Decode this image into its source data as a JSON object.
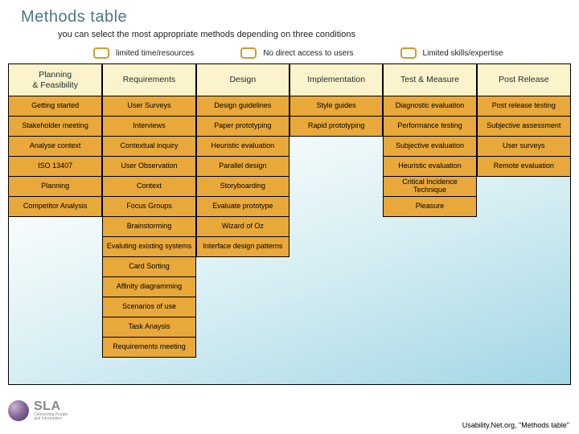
{
  "title": "Methods table",
  "subtitle": "you can select the most appropriate methods depending on three conditions",
  "legend": [
    {
      "label": "limited time/resources"
    },
    {
      "label": "No direct access to users"
    },
    {
      "label": "Limited skills/expertise"
    }
  ],
  "columns": [
    {
      "header": "Planning\n& Feasibility",
      "methods": [
        "Getting started",
        "Stakeholder meeting",
        "Analyse context",
        "ISO 13407",
        "Planning",
        "Competitor Analysis"
      ]
    },
    {
      "header": "Requirements",
      "methods": [
        "User Surveys",
        "Interviews",
        "Contextual inquiry",
        "User Observation",
        "Context",
        "Focus Groups",
        "Brainstorming",
        "Evaluting existing systems",
        "Card Sorting",
        "Affinity diagramming",
        "Scenarios of use",
        "Task Anaysis",
        "Requirements meeting"
      ]
    },
    {
      "header": "Design",
      "methods": [
        "Design guidelines",
        "Paper prototyping",
        "Heuristic evaluation",
        "Parallel design",
        "Storyboarding",
        "Evaluate prototype",
        "Wizard of Oz",
        "Interface design patterns"
      ]
    },
    {
      "header": "Implementation",
      "methods": [
        "Style guides",
        "Rapid prototyping"
      ]
    },
    {
      "header": "Test & Measure",
      "methods": [
        "Diagnostic evaluation",
        "Performance testing",
        "Subjective evaluation",
        "Heuristic evaluation",
        "Critical Incidence Technique",
        "Pleasure"
      ]
    },
    {
      "header": "Post Release",
      "methods": [
        "Post release testing",
        "Subjective assessment",
        "User surveys",
        "Remote evaluation"
      ]
    }
  ],
  "logo": {
    "text": "SLA",
    "sub1": "Connecting People",
    "sub2": "and Information"
  },
  "credit": "Usability.Net.org, \"Methods table\""
}
